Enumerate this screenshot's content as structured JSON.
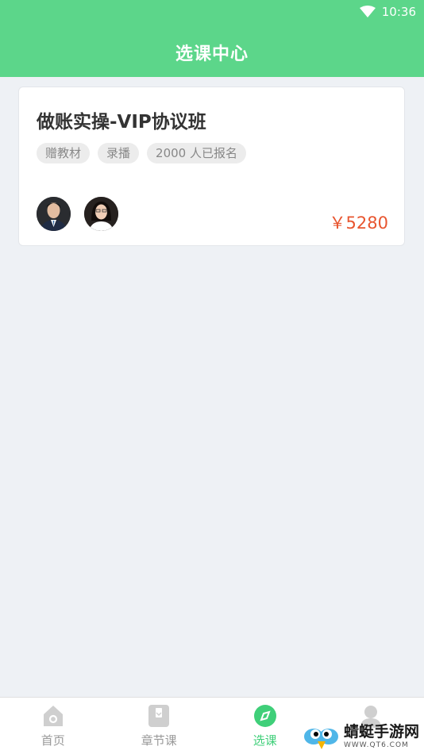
{
  "status_bar": {
    "time": "10:36"
  },
  "header": {
    "title": "选课中心"
  },
  "course": {
    "title": "做账实操-VIP协议班",
    "tags": [
      "赠教材",
      "录播",
      "2000 人已报名"
    ],
    "price": "￥5280"
  },
  "tabbar": {
    "items": [
      {
        "label": "首页",
        "icon": "home-icon"
      },
      {
        "label": "章节课",
        "icon": "book-icon"
      },
      {
        "label": "选课",
        "icon": "compass-icon"
      },
      {
        "label": "",
        "icon": "user-icon"
      }
    ],
    "active_index": 2
  },
  "watermark": {
    "text": "蜻蜓手游网",
    "url": "WWW.QT6.COM"
  },
  "colors": {
    "header": "#5cd68a",
    "price": "#e8552f",
    "active_tab": "#3fcf79"
  }
}
